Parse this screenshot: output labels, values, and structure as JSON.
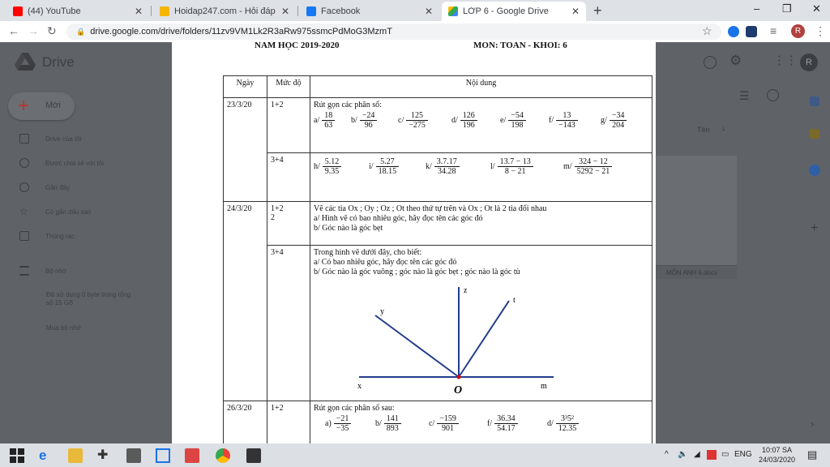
{
  "browser": {
    "tabs": [
      {
        "title": "(44) YouTube",
        "favicon_color": "#ff0000",
        "active": false
      },
      {
        "title": "Hoidap247.com - Hỏi đáp bài tập",
        "favicon_color": "#f4b400",
        "active": false
      },
      {
        "title": "Facebook",
        "favicon_color": "#1877f2",
        "active": false
      },
      {
        "title": "LỚP 6 - Google Drive",
        "favicon_color": "#34a853",
        "active": true
      }
    ],
    "new_tab": "+",
    "window_controls": [
      "–",
      "❐",
      "✕"
    ],
    "url": "drive.google.com/drive/folders/11zv9VM1Lk2R3aRw975ssmcPdMoG3MzmT",
    "profile_initial": "R"
  },
  "drive": {
    "brand": "Drive",
    "new_button": "Mới",
    "nav": [
      {
        "label": "Drive của tôi",
        "icon": "my-drive-icon"
      },
      {
        "label": "Được chia sẻ với tôi",
        "icon": "shared-icon"
      },
      {
        "label": "Gần đây",
        "icon": "recent-icon"
      },
      {
        "label": "Có gắn dấu sao",
        "icon": "star-icon"
      },
      {
        "label": "Thùng rác",
        "icon": "trash-icon"
      }
    ],
    "storage_label": "Bộ nhớ",
    "storage_used": "Đã sử dụng 0 byte trong tổng số 15 GB",
    "buy_storage": "Mua bộ nhớ",
    "sort_label": "Tên",
    "file_name": "MÔN ANH 6.docx",
    "profile_initial": "R"
  },
  "document": {
    "header_left": "NĂM HỌC 2019-2020",
    "header_right": "MÔN: TOÁN - KHỐI: 6",
    "col_headers": [
      "Ngày",
      "Mức độ",
      "Nội dung"
    ],
    "rows": {
      "r1": {
        "date": "23/3/20",
        "level": "1+2",
        "title": "Rút gọn các phân số:",
        "fractions": [
          {
            "label": "a/",
            "num": "18",
            "den": "63"
          },
          {
            "label": "b/",
            "num": "−24",
            "den": "96"
          },
          {
            "label": "c/",
            "num": "125",
            "den": "−275"
          },
          {
            "label": "d/",
            "num": "126",
            "den": "196"
          },
          {
            "label": "e/",
            "num": "−54",
            "den": "198"
          },
          {
            "label": "f/",
            "num": "13",
            "den": "−143"
          },
          {
            "label": "g/",
            "num": "−34",
            "den": "204"
          }
        ]
      },
      "r2": {
        "level": "3+4",
        "fractions": [
          {
            "label": "h/",
            "num": "5.12",
            "den": "9.35"
          },
          {
            "label": "i/",
            "num": "5.27",
            "den": "18.15"
          },
          {
            "label": "k/",
            "num": "3.7.17",
            "den": "34.28"
          },
          {
            "label": "l/",
            "num": "13.7 − 13",
            "den": "8 − 21"
          },
          {
            "label": "m/",
            "num": "324 − 12",
            "den": "5292 − 21"
          }
        ]
      },
      "r3": {
        "date": "24/3/20",
        "level": "1+2",
        "level_extra": "2",
        "line1": "Vẽ các tia Ox ; Oy ; Oz ; Ot theo thứ tự trên và Ox ; Ot là 2 tia đối nhau",
        "line2": "a/ Hình vẽ có bao nhiêu góc, hãy đọc tên các góc đó",
        "line3": "b/ Góc nào là góc bẹt"
      },
      "r4": {
        "level": "3+4",
        "line1": "Trong hình vẽ dưới đây, cho biết:",
        "line2": "a/ Có bao nhiêu góc, hãy đọc tên các góc đó",
        "line3": "b/ Góc nào là góc vuông ; góc nào là góc bẹt ; góc nào là góc tù",
        "figure_labels": {
          "x": "x",
          "y": "y",
          "z": "z",
          "t": "t",
          "m": "m",
          "o": "O"
        }
      },
      "r5": {
        "date": "26/3/20",
        "level": "1+2",
        "title": "Rút gọn các phân số sau:",
        "fractions": [
          {
            "label": "a)",
            "num": "−21",
            "den": "−35"
          },
          {
            "label": "b/",
            "num": "141",
            "den": "893"
          },
          {
            "label": "c/",
            "num": "−159",
            "den": "901"
          },
          {
            "label": "f/",
            "num": "36.34",
            "den": "54.17"
          },
          {
            "label": "d/",
            "num": "3³5²",
            "den": "12.35"
          }
        ]
      }
    }
  },
  "taskbar": {
    "lang": "ENG",
    "time": "10:07 SA",
    "date": "24/03/2020"
  }
}
